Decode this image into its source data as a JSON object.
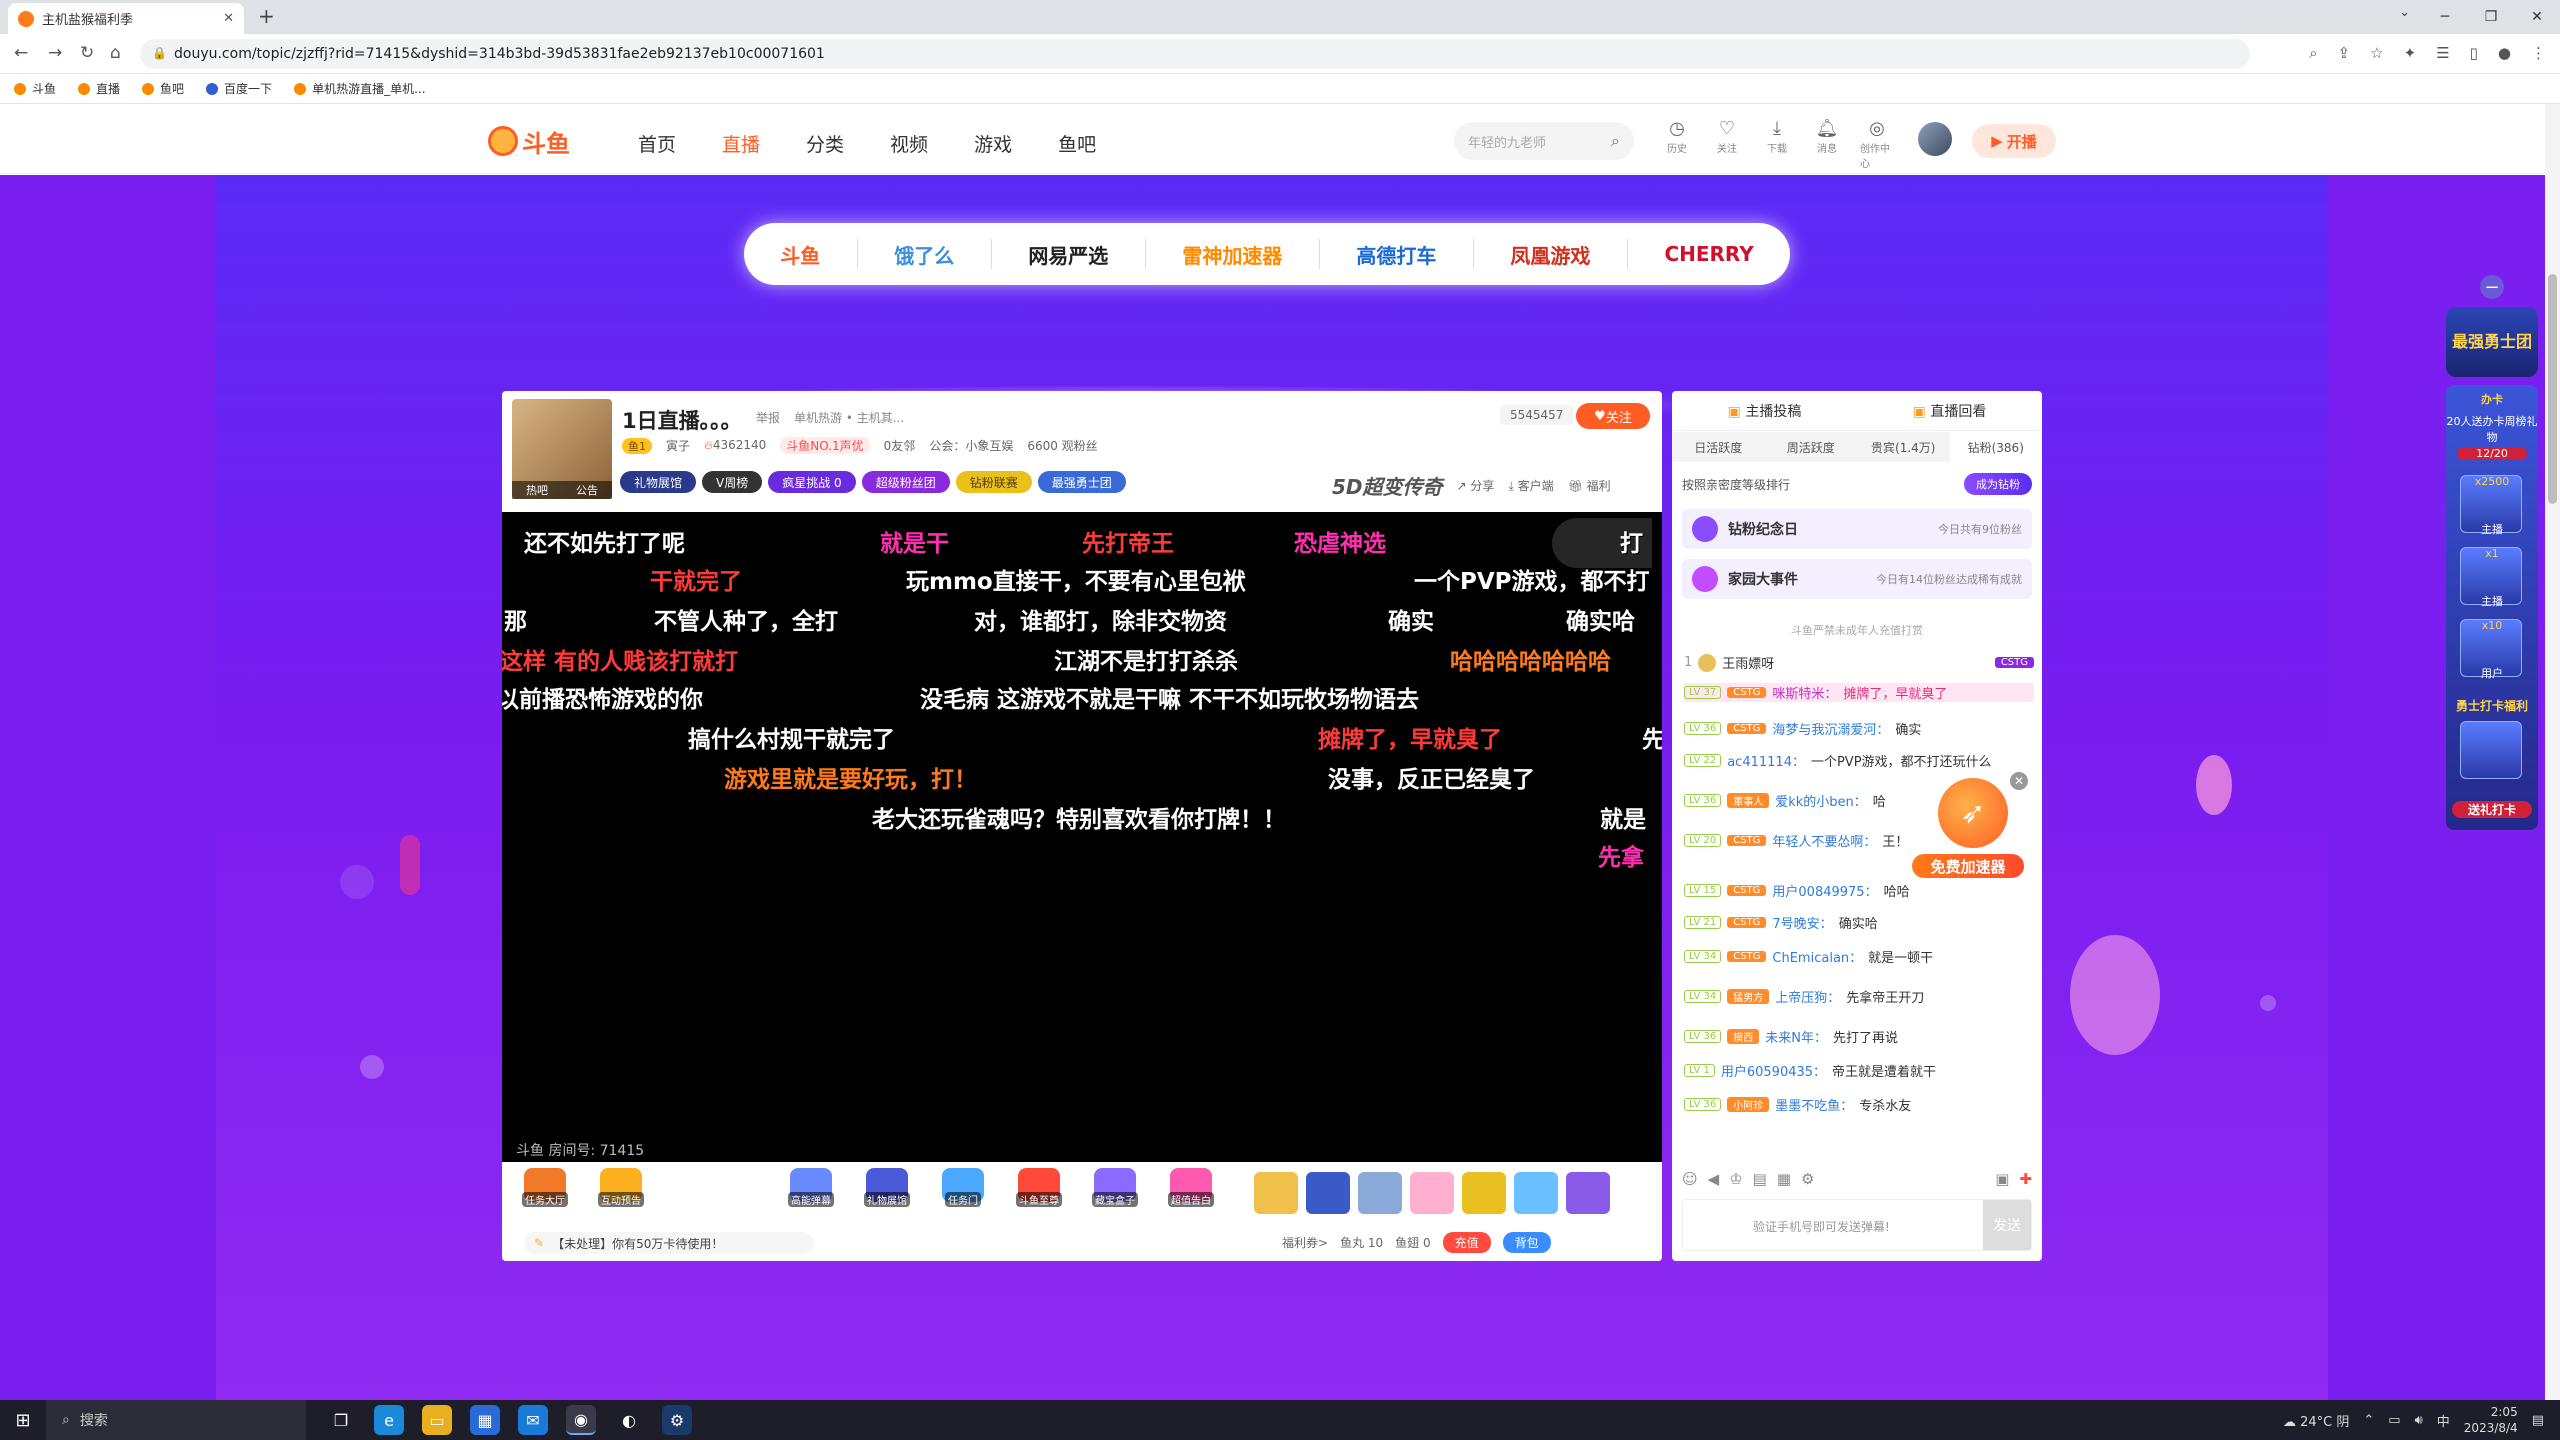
{
  "browser": {
    "tab_title": "主机盐猴福利季",
    "url": "douyu.com/topic/zjzffj?rid=71415&dyshid=314b3bd-39d53831fae2eb92137eb10c00071601",
    "bookmarks": [
      "斗鱼",
      "直播",
      "鱼吧",
      "百度一下",
      "单机热游直播_单机..."
    ]
  },
  "header": {
    "nav": [
      "首页",
      "直播",
      "分类",
      "视频",
      "游戏",
      "鱼吧"
    ],
    "active_nav": "直播",
    "search_placeholder": "年轻的九老师",
    "icons": [
      {
        "label": "历史",
        "icon": "history-icon"
      },
      {
        "label": "关注",
        "icon": "heart-icon"
      },
      {
        "label": "下载",
        "icon": "download-icon"
      },
      {
        "label": "消息",
        "icon": "bell-icon"
      },
      {
        "label": "创作中心",
        "icon": "bulb-icon"
      }
    ],
    "start_button": "开播"
  },
  "sponsors": [
    "斗鱼",
    "饿了么",
    "网易严选",
    "雷神加速器",
    "高德打车",
    "凤凰游戏",
    "CHERRY"
  ],
  "room": {
    "title": "1日直播。。。",
    "report": "举报",
    "category": "单机热游 • 主机其...",
    "avatar_labels": [
      "热吧",
      "公告"
    ],
    "level_badge": "鱼1",
    "guild": "寅子",
    "heat": "4362140",
    "rank_badge": "斗鱼NO.1声优",
    "friends": "0友邻",
    "union": "公会：小象互娱",
    "fans": "6600 观粉丝",
    "pills": [
      "礼物展馆",
      "V周榜",
      "疯星挑战  0",
      "超级粉丝团",
      "钻粉联赛",
      "最强勇士团"
    ],
    "follow_count": "5545457",
    "follow_label": "关注",
    "tool_brand": "5D超变传奇",
    "tools": [
      "分享",
      "客户端",
      "福利"
    ],
    "room_no": "斗鱼 房间号: 71415"
  },
  "danmaku": [
    {
      "text": "还不如先打了呢",
      "c": "w"
    },
    {
      "text": "就是干",
      "c": "m"
    },
    {
      "text": "先打帝王",
      "c": "r"
    },
    {
      "text": "恐虐神选",
      "c": "m"
    },
    {
      "text": "打",
      "c": "w"
    },
    {
      "text": "干就完了",
      "c": "r"
    },
    {
      "text": "玩mmo直接干，不要有心里包袱",
      "c": "w"
    },
    {
      "text": "一个PVP游戏，都不打",
      "c": "w"
    },
    {
      "text": "那",
      "c": "w"
    },
    {
      "text": "不管人种了，全打",
      "c": "w"
    },
    {
      "text": "对，谁都打，除非交物资",
      "c": "w"
    },
    {
      "text": "确实",
      "c": "w"
    },
    {
      "text": "确实哈",
      "c": "w"
    },
    {
      "text": "这样 有的人贱该打就打",
      "c": "r"
    },
    {
      "text": "江湖不是打打杀杀",
      "c": "w"
    },
    {
      "text": "哈哈哈哈哈哈哈",
      "c": "o"
    },
    {
      "text": "以前播恐怖游戏的你",
      "c": "w"
    },
    {
      "text": "没毛病 这游戏不就是干嘛 不干不如玩牧场物语去",
      "c": "w"
    },
    {
      "text": "搞什么村规干就完了",
      "c": "w"
    },
    {
      "text": "摊牌了，早就臭了",
      "c": "r"
    },
    {
      "text": "先",
      "c": "w"
    },
    {
      "text": "游戏里就是要好玩，打！",
      "c": "o"
    },
    {
      "text": "没事，反正已经臭了",
      "c": "w"
    },
    {
      "text": "老大还玩雀魂吗？特别喜欢看你打牌！！",
      "c": "w"
    },
    {
      "text": "就是",
      "c": "w"
    },
    {
      "text": "先拿",
      "c": "m"
    }
  ],
  "gifts": [
    {
      "label": "任务大厅",
      "color": "#f07a2a"
    },
    {
      "label": "互动预告",
      "color": "#ffb020"
    },
    {
      "label": "高能弹幕",
      "color": "#6a8aff"
    },
    {
      "label": "礼物展馆",
      "color": "#4a5ad8"
    },
    {
      "label": "任务门",
      "color": "#4aa8ff"
    },
    {
      "label": "斗鱼至尊",
      "color": "#ff4a3a"
    },
    {
      "label": "藏宝盒子",
      "color": "#8a6aff"
    },
    {
      "label": "超值告白",
      "color": "#ff5ab0"
    }
  ],
  "gift_items": [
    "#f0c14a",
    "#3a5ac8",
    "#8aa8d8",
    "#ffb0d0",
    "#e8c020",
    "#6ac0ff",
    "#8a5ae8"
  ],
  "player_bottom": {
    "notice": "【未处理】你有50万卡待使用！",
    "welfare": "福利券>",
    "fishball": "鱼丸 10",
    "fishwing": "鱼翅 0",
    "recharge": "充值",
    "bag": "背包"
  },
  "chat": {
    "top_tabs": [
      "主播投稿",
      "直播回看"
    ],
    "rank_tabs": [
      "日活跃度",
      "周活跃度",
      "贵宾(1.4万)",
      "钻粉(386)"
    ],
    "rank_hint": "按照亲密度等级排行",
    "become_fan": "成为钻粉",
    "event1": {
      "title": "钻粉纪念日",
      "sub": "今日共有9位粉丝"
    },
    "event2": {
      "title": "家园大事件",
      "sub": "今日有14位粉丝达成稀有成就"
    },
    "tip": "斗鱼严禁未成年人充值打赏",
    "top_fan": {
      "rank": "1",
      "name": "王雨嫖呀",
      "tag": "CSTG"
    },
    "messages": [
      {
        "lv": "LV 37",
        "tag": "CSTG",
        "name": "咪斯特米：",
        "text": "摊牌了，早就臭了",
        "pink": true
      },
      {
        "lv": "LV 36",
        "tag": "CSTG",
        "name": "海梦与我沉溺爱河：",
        "text": "确实"
      },
      {
        "lv": "LV 22",
        "tag": "",
        "name": "ac411114：",
        "text": "一个PVP游戏，都不打还玩什么"
      },
      {
        "lv": "LV 36",
        "tag": "軍事人",
        "name": "爱kk的小ben：",
        "text": "哈"
      },
      {
        "lv": "LV 20",
        "tag": "CSTG",
        "name": "年轻人不要怂啊：",
        "text": "王！"
      },
      {
        "lv": "LV 15",
        "tag": "CSTG",
        "name": "用户00849975：",
        "text": "哈哈"
      },
      {
        "lv": "LV 21",
        "tag": "CSTG",
        "name": "7号晚安：",
        "text": "确实哈"
      },
      {
        "lv": "LV 34",
        "tag": "CSTG",
        "name": "ChEmicalan：",
        "text": "就是一顿干"
      },
      {
        "lv": "LV 34",
        "tag": "猛男方",
        "name": "上帝压狗：",
        "text": "先拿帝王开刀"
      },
      {
        "lv": "LV 36",
        "tag": "摸西",
        "name": "未来N年：",
        "text": "先打了再说"
      },
      {
        "lv": "LV 1",
        "tag": "",
        "name": "用户60590435：",
        "text": "帝王就是遭着就干"
      },
      {
        "lv": "LV 36",
        "tag": "小阿珍",
        "name": "墨墨不吃鱼：",
        "text": "专杀水友"
      }
    ],
    "input_placeholder": "验证手机号即可发送弹幕!",
    "send": "发送"
  },
  "accelerator": {
    "label": "免费加速器"
  },
  "right_column": {
    "badge": "最强勇士团",
    "item1": "办卡",
    "text1": "20人送办卡周榜礼物",
    "progress": "12/20",
    "amounts": [
      "x2500",
      "x1",
      "x10"
    ],
    "roles": [
      "主播",
      "主播",
      "用户"
    ],
    "bottom_title": "勇士打卡福利",
    "bottom_btn": "送礼打卡"
  },
  "taskbar": {
    "search": "搜索",
    "weather": "24°C 阴",
    "ime": "中",
    "time": "2:05",
    "date": "2023/8/4"
  }
}
